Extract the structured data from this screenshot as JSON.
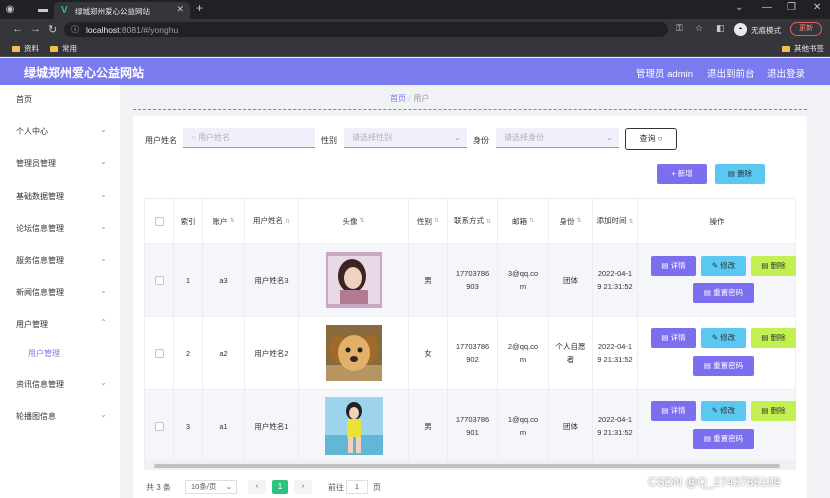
{
  "browser": {
    "tab_title": "绿城郑州爱心公益网站",
    "url_host": "localhost",
    "url_rest": ":8081/#/yonghu",
    "incognito_label": "无痕模式",
    "update_label": "更新",
    "bookmarks": [
      "资料",
      "常用"
    ],
    "other_bookmarks": "其他书签"
  },
  "header": {
    "title": "绿城郑州爱心公益网站",
    "admin_label": "管理员 admin",
    "back_label": "退出到前台",
    "logout_label": "退出登录"
  },
  "sidebar": {
    "items": [
      "首页",
      "个人中心",
      "管理员管理",
      "基础数据管理",
      "论坛信息管理",
      "服务信息管理",
      "新闻信息管理",
      "用户管理",
      "资讯信息管理",
      "轮播图信息"
    ],
    "sub_item": "用户管理"
  },
  "breadcrumb": {
    "home": "首页",
    "current": "用户"
  },
  "filters": {
    "name_label": "用户姓名",
    "name_placeholder": "用户姓名",
    "gender_label": "性别",
    "gender_placeholder": "请选择性别",
    "identity_label": "身份",
    "identity_placeholder": "请选择身份",
    "query_label": "查询"
  },
  "actions": {
    "add": "新增",
    "delete": "删除"
  },
  "table": {
    "headers": [
      "索引",
      "账户",
      "用户姓名",
      "头像",
      "性别",
      "联系方式",
      "邮箱",
      "身份",
      "添加时间",
      "操作"
    ],
    "rows": [
      {
        "index": "1",
        "account": "a3",
        "name": "用户姓名3",
        "gender": "男",
        "phone": "17703786903",
        "email": "3@qq.com",
        "identity": "团体",
        "time": "2022-04-19 21:31:52"
      },
      {
        "index": "2",
        "account": "a2",
        "name": "用户姓名2",
        "gender": "女",
        "phone": "17703786902",
        "email": "2@qq.com",
        "identity": "个人自愿者",
        "time": "2022-04-19 21:31:52"
      },
      {
        "index": "3",
        "account": "a1",
        "name": "用户姓名1",
        "gender": "男",
        "phone": "17703786901",
        "email": "1@qq.com",
        "identity": "团体",
        "time": "2022-04-19 21:31:52"
      }
    ],
    "row_actions": {
      "detail": "详情",
      "edit": "修改",
      "delete": "删除",
      "reset": "重置密码"
    }
  },
  "pagination": {
    "total": "共 3 条",
    "page_size": "10条/页",
    "current_page": "1",
    "goto_label": "前往",
    "goto_value": "1",
    "page_suffix": "页"
  },
  "watermark": "CSDN @Q_2743785109",
  "colors": {
    "accent": "#7b7bf0",
    "page_active": "#2ec27e"
  }
}
